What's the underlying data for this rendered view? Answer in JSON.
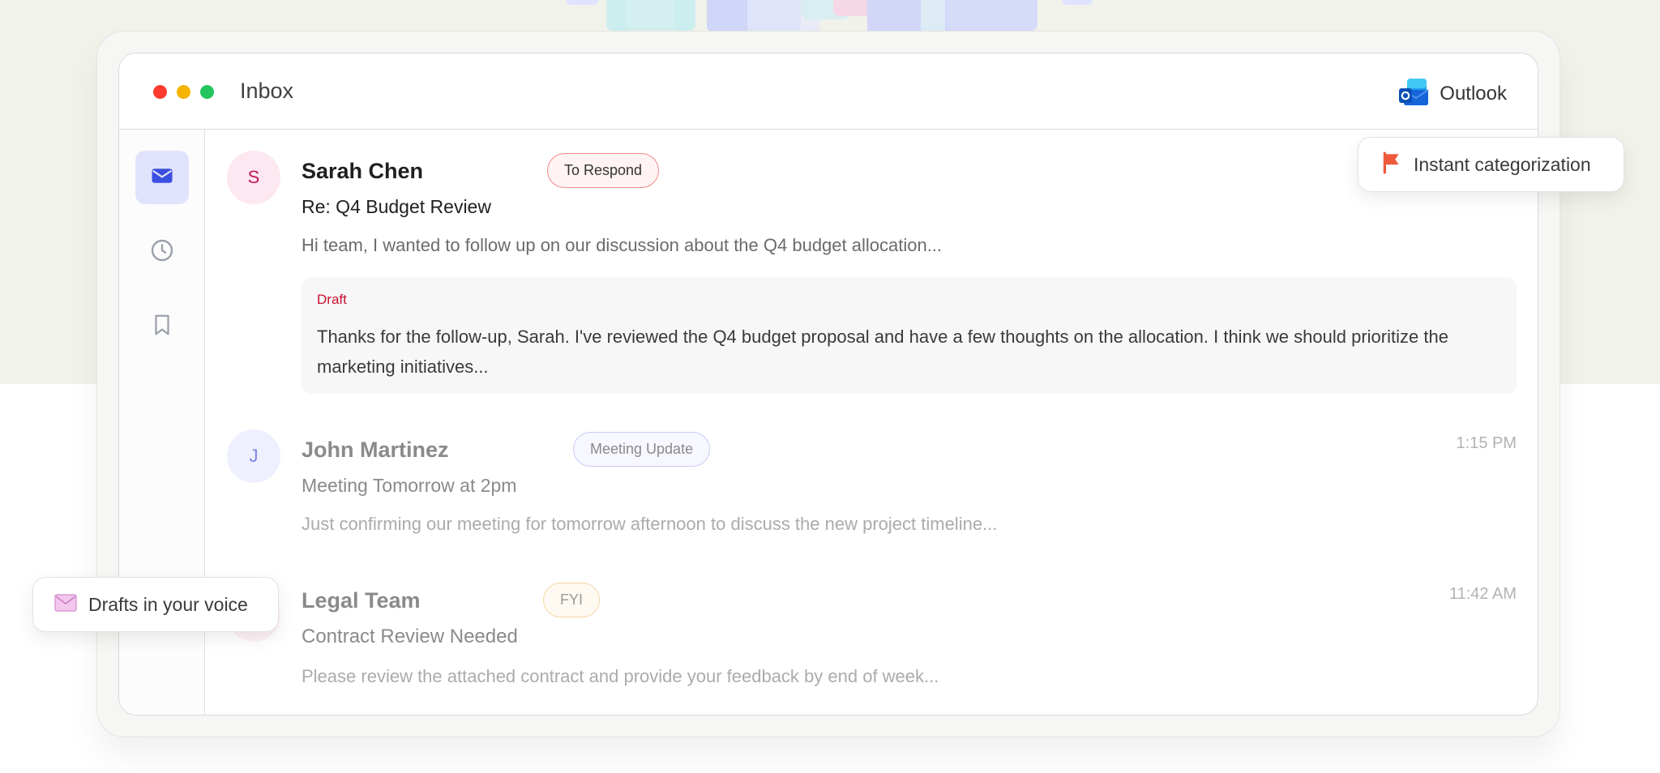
{
  "window": {
    "title": "Inbox",
    "brand_label": "Outlook"
  },
  "sidebar": {
    "items": [
      {
        "icon": "envelope-icon",
        "active": true
      },
      {
        "icon": "clock-icon",
        "active": false
      },
      {
        "icon": "bookmark-icon",
        "active": false
      }
    ]
  },
  "emails": [
    {
      "initial": "S",
      "sender": "Sarah Chen",
      "tag": "To Respond",
      "subject": "Re: Q4 Budget Review",
      "preview": "Hi team, I wanted to follow up on our discussion about the Q4 budget allocation...",
      "time": "",
      "draft_label": "Draft",
      "draft_text": "Thanks for the follow-up, Sarah. I've reviewed the Q4 budget proposal and have a few thoughts on the allocation. I think we should prioritize the marketing initiatives..."
    },
    {
      "initial": "J",
      "sender": "John Martinez",
      "tag": "Meeting Update",
      "subject": "Meeting Tomorrow at 2pm",
      "preview": "Just confirming our meeting for tomorrow afternoon to discuss the new project timeline...",
      "time": "1:15 PM"
    },
    {
      "initial": "",
      "sender": "Legal Team",
      "tag": "FYI",
      "subject": "Contract Review Needed",
      "preview": "Please review the attached contract and provide your feedback by end of week...",
      "time": "11:42 AM"
    }
  ],
  "callouts": {
    "categorization": "Instant categorization",
    "drafts": "Drafts in your voice"
  },
  "colors": {
    "accent": "#3b4fe0",
    "to_respond": "#e04848",
    "meeting_update": "#8b8fe8",
    "fyi": "#e8b56a",
    "draft_label": "#c8102e"
  }
}
